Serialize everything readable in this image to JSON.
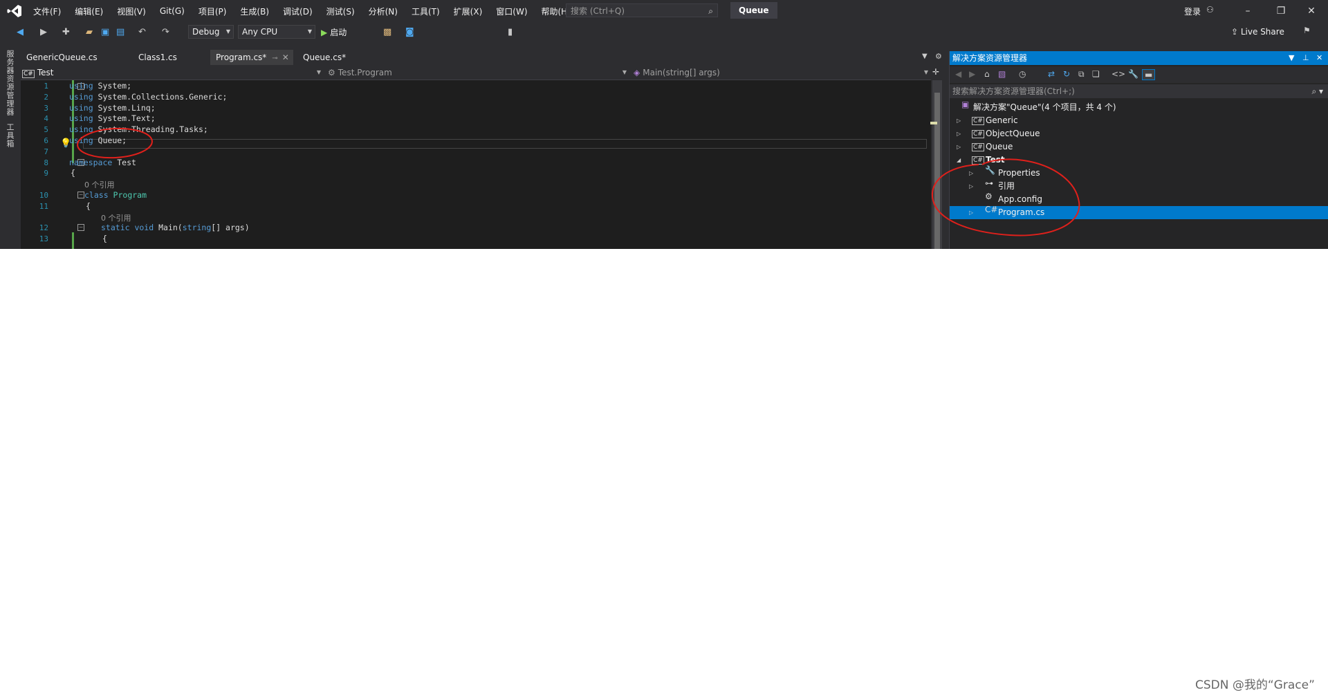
{
  "menu": {
    "items": [
      "文件(F)",
      "编辑(E)",
      "视图(V)",
      "Git(G)",
      "项目(P)",
      "生成(B)",
      "调试(D)",
      "测试(S)",
      "分析(N)",
      "工具(T)",
      "扩展(X)",
      "窗口(W)",
      "帮助(H)"
    ],
    "search_placeholder": "搜索 (Ctrl+Q)",
    "solution_name": "Queue",
    "login": "登录"
  },
  "toolbar": {
    "config": "Debug",
    "platform": "Any CPU",
    "start": "启动",
    "live_share": "Live Share"
  },
  "left_strip": {
    "server_explorer": "服务器资源管理器",
    "toolbox": "工具箱"
  },
  "tabs": [
    {
      "label": "GenericQueue.cs"
    },
    {
      "label": "Class1.cs"
    },
    {
      "label": "Program.cs*"
    },
    {
      "label": "Queue.cs*"
    }
  ],
  "navbar": {
    "project": "Test",
    "type": "Test.Program",
    "member": "Main(string[] args)"
  },
  "editor": {
    "line_numbers": [
      "1",
      "2",
      "3",
      "4",
      "5",
      "6",
      "7",
      "8",
      "9",
      "",
      "10",
      "11",
      "",
      "12",
      "13"
    ],
    "lines": [
      {
        "kw": "using",
        "rest": " System;"
      },
      {
        "kw": "using",
        "rest": " System.Collections.Generic;"
      },
      {
        "kw": "using",
        "rest": " System.Linq;"
      },
      {
        "kw": "using",
        "rest": " System.Text;"
      },
      {
        "kw": "using",
        "rest": " System.Threading.Tasks;"
      },
      {
        "kw": "using",
        "rest": " Queue;"
      },
      {
        "kw": "",
        "rest": ""
      },
      {
        "kw": "namespace",
        "rest": " Test"
      },
      {
        "kw": "",
        "rest": "{"
      },
      {
        "ref": "0 个引用"
      },
      {
        "kw": "class",
        "type": " Program"
      },
      {
        "kw": "",
        "rest": "{"
      },
      {
        "ref": "0 个引用"
      },
      {
        "kw": "static void",
        "rest": " Main(",
        "kw2": "string",
        "rest2": "[] args)"
      },
      {
        "kw": "",
        "rest": "{"
      }
    ]
  },
  "solution_explorer": {
    "title": "解决方案资源管理器",
    "search_placeholder": "搜索解决方案资源管理器(Ctrl+;)",
    "root": "解决方案\"Queue\"(4 个项目，共 4 个)",
    "items": [
      {
        "label": "Generic",
        "icon": "csharp-project-icon"
      },
      {
        "label": "ObjectQueue",
        "icon": "csharp-project-icon"
      },
      {
        "label": "Queue",
        "icon": "csharp-project-icon"
      },
      {
        "label": "Test",
        "icon": "csharp-project-icon"
      },
      {
        "label": "Properties",
        "icon": "wrench-icon"
      },
      {
        "label": "引用",
        "icon": "references-icon"
      },
      {
        "label": "App.config",
        "icon": "config-file-icon"
      },
      {
        "label": "Program.cs",
        "icon": "csharp-file-icon"
      }
    ]
  },
  "watermark": "CSDN @我的“Grace”",
  "colors": {
    "accent": "#007acc",
    "annotation": "#e0201b",
    "chrome": "#2d2d30",
    "editor_bg": "#1e1e1e"
  }
}
